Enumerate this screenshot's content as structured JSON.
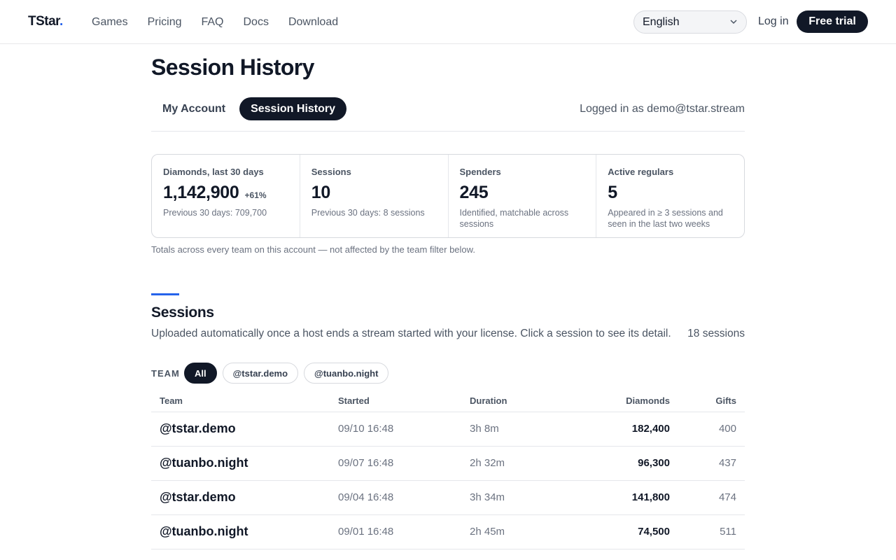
{
  "brand": {
    "name": "TStar",
    "dot": "."
  },
  "nav": {
    "items": [
      "Games",
      "Pricing",
      "FAQ",
      "Docs",
      "Download"
    ]
  },
  "header": {
    "language": "English",
    "login": "Log in",
    "cta": "Free trial"
  },
  "page": {
    "title": "Session History",
    "tabs": [
      "My Account",
      "Session History"
    ],
    "logged_in": "Logged in as demo@tstar.stream"
  },
  "stats": [
    {
      "label": "Diamonds, last 30 days",
      "value": "1,142,900",
      "delta": "+61%",
      "sub": "Previous 30 days: 709,700"
    },
    {
      "label": "Sessions",
      "value": "10",
      "delta": "",
      "sub": "Previous 30 days: 8 sessions"
    },
    {
      "label": "Spenders",
      "value": "245",
      "delta": "",
      "sub": "Identified, matchable across sessions"
    },
    {
      "label": "Active regulars",
      "value": "5",
      "delta": "",
      "sub": "Appeared in ≥ 3 sessions and seen in the last two weeks"
    }
  ],
  "totals_note": "Totals across every team on this account — not affected by the team filter below.",
  "sessions": {
    "title": "Sessions",
    "description": "Uploaded automatically once a host ends a stream started with your license. Click a session to see its detail.",
    "count": "18 sessions",
    "filter_label": "TEAM",
    "filters": [
      "All",
      "@tstar.demo",
      "@tuanbo.night"
    ],
    "columns": [
      "Team",
      "Started",
      "Duration",
      "Diamonds",
      "Gifts"
    ],
    "rows": [
      [
        "@tstar.demo",
        "09/10 16:48",
        "3h 8m",
        "182,400",
        "400"
      ],
      [
        "@tuanbo.night",
        "09/07 16:48",
        "2h 32m",
        "96,300",
        "437"
      ],
      [
        "@tstar.demo",
        "09/04 16:48",
        "3h 34m",
        "141,800",
        "474"
      ],
      [
        "@tuanbo.night",
        "09/01 16:48",
        "2h 45m",
        "74,500",
        "511"
      ]
    ]
  },
  "colors": {
    "accent": "#2563eb",
    "dark": "#111827",
    "border": "#e5e7eb"
  }
}
